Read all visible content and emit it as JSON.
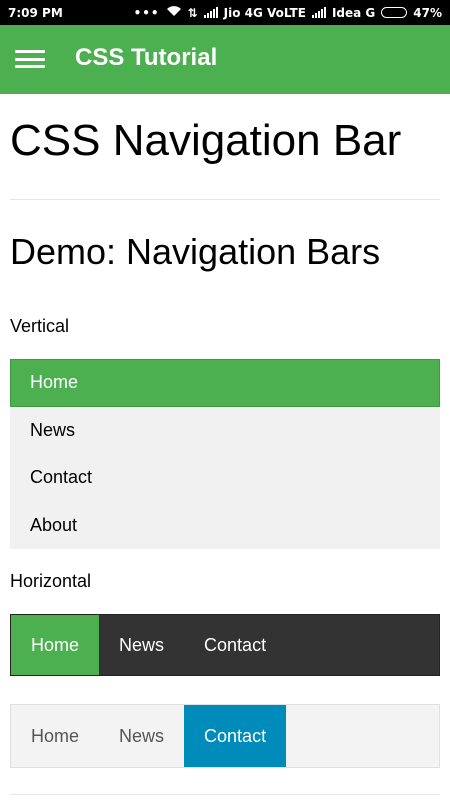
{
  "status_bar": {
    "time": "7:09 PM",
    "carrier1": "Jio 4G VoLTE",
    "carrier2": "Idea G",
    "battery": "47%",
    "battery_level": 0.47
  },
  "app_bar": {
    "title": "CSS Tutorial",
    "menu_icon": "hamburger-menu-icon",
    "color": "#4caf50"
  },
  "page": {
    "title": "CSS Navigation Bar",
    "demo_title": "Demo: Navigation Bars",
    "vertical_label": "Vertical",
    "horizontal_label": "Horizontal"
  },
  "vertical_nav": {
    "items": [
      {
        "label": "Home"
      },
      {
        "label": "News"
      },
      {
        "label": "Contact"
      },
      {
        "label": "About"
      }
    ],
    "active_color": "#4caf50"
  },
  "horizontal_nav_dark": {
    "items": [
      {
        "label": "Home"
      },
      {
        "label": "News"
      },
      {
        "label": "Contact"
      }
    ],
    "active_color": "#4caf50",
    "background": "#333333"
  },
  "horizontal_nav_light": {
    "items": [
      {
        "label": "Home"
      },
      {
        "label": "News"
      },
      {
        "label": "Contact"
      }
    ],
    "active_color": "#008cba",
    "background": "#f3f3f3"
  }
}
